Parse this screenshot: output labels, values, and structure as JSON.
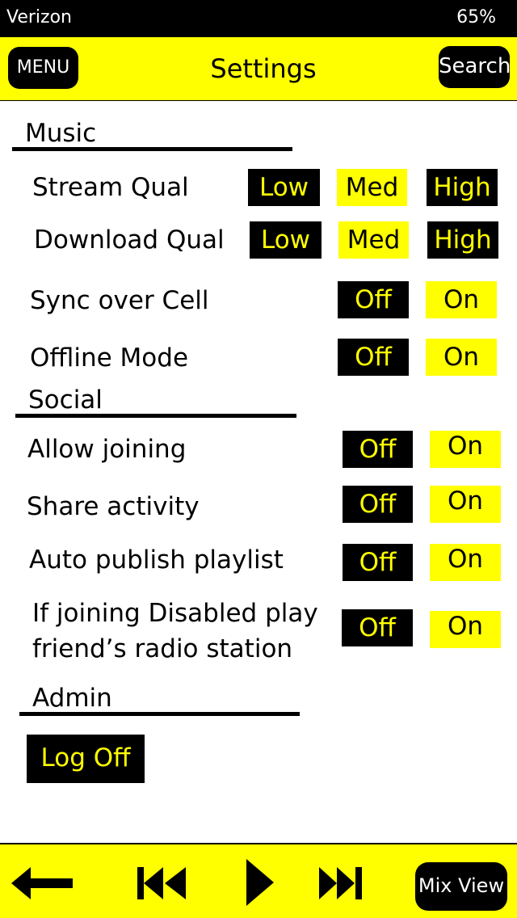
{
  "status": {
    "carrier": "Verizon",
    "battery": "65%"
  },
  "header": {
    "menu_label": "MENU",
    "title": "Settings",
    "search_label": "Search"
  },
  "music": {
    "heading": "Music",
    "stream": {
      "label": "Stream Qual",
      "options": [
        "Low",
        "Med",
        "High"
      ]
    },
    "download": {
      "label": "Download Qual",
      "options": [
        "Low",
        "Med",
        "High"
      ]
    },
    "sync": {
      "label": "Sync over Cell",
      "off": "Off",
      "on": "On"
    },
    "offline": {
      "label": "Offline Mode",
      "off": "Off",
      "on": "On"
    }
  },
  "social": {
    "heading": "Social",
    "allow_joining": {
      "label": "Allow joining",
      "off": "Off",
      "on": "On"
    },
    "share_activity": {
      "label": "Share activity",
      "off": "Off",
      "on": "On"
    },
    "auto_publish": {
      "label": "Auto publish playlist",
      "off": "Off",
      "on": "On"
    },
    "if_disabled": {
      "label_line1": "If joining Disabled play",
      "label_line2": "friend’s radio station",
      "off": "Off",
      "on": "On"
    }
  },
  "admin": {
    "heading": "Admin",
    "logoff_label": "Log Off"
  },
  "player": {
    "mix_view_label": "Mix View"
  },
  "colors": {
    "accent": "#ffff00",
    "dark": "#000000",
    "background": "#ffffff"
  },
  "icons": [
    "back-arrow-icon",
    "skip-previous-icon",
    "play-icon",
    "skip-next-icon"
  ]
}
